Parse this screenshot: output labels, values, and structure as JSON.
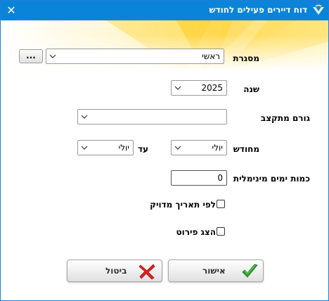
{
  "window": {
    "title": "דוח דיירים פעילים לחודש",
    "close_label": "✕",
    "title_bar_color": "#0a84d8",
    "icon": "app-logo-icon"
  },
  "form": {
    "framework": {
      "label": "מסגרת",
      "value": "ראשי",
      "button_label": "..."
    },
    "year": {
      "label": "שנה",
      "value": "2025"
    },
    "funding_body": {
      "label": "גורם מתקצב",
      "value": ""
    },
    "month_from": {
      "label": "מחודש",
      "value": "יולי"
    },
    "month_to": {
      "label": "עד",
      "value": "יולי"
    },
    "min_days": {
      "label": "כמות ימים מינימלית",
      "value": "0"
    },
    "exact_date": {
      "label": "לפי תאריך מדויק",
      "checked": false
    },
    "show_details": {
      "label": "הצג פירוט",
      "checked": false
    }
  },
  "buttons": {
    "ok": {
      "label": "אישור",
      "icon": "green-checkmark-icon"
    },
    "cancel": {
      "label": "ביטול",
      "icon": "red-x-icon"
    }
  },
  "colors": {
    "accent": "#0a84d8",
    "ok_icon": "#2aa02a",
    "cancel_icon": "#e0201c",
    "banner": "#f8d23a"
  }
}
